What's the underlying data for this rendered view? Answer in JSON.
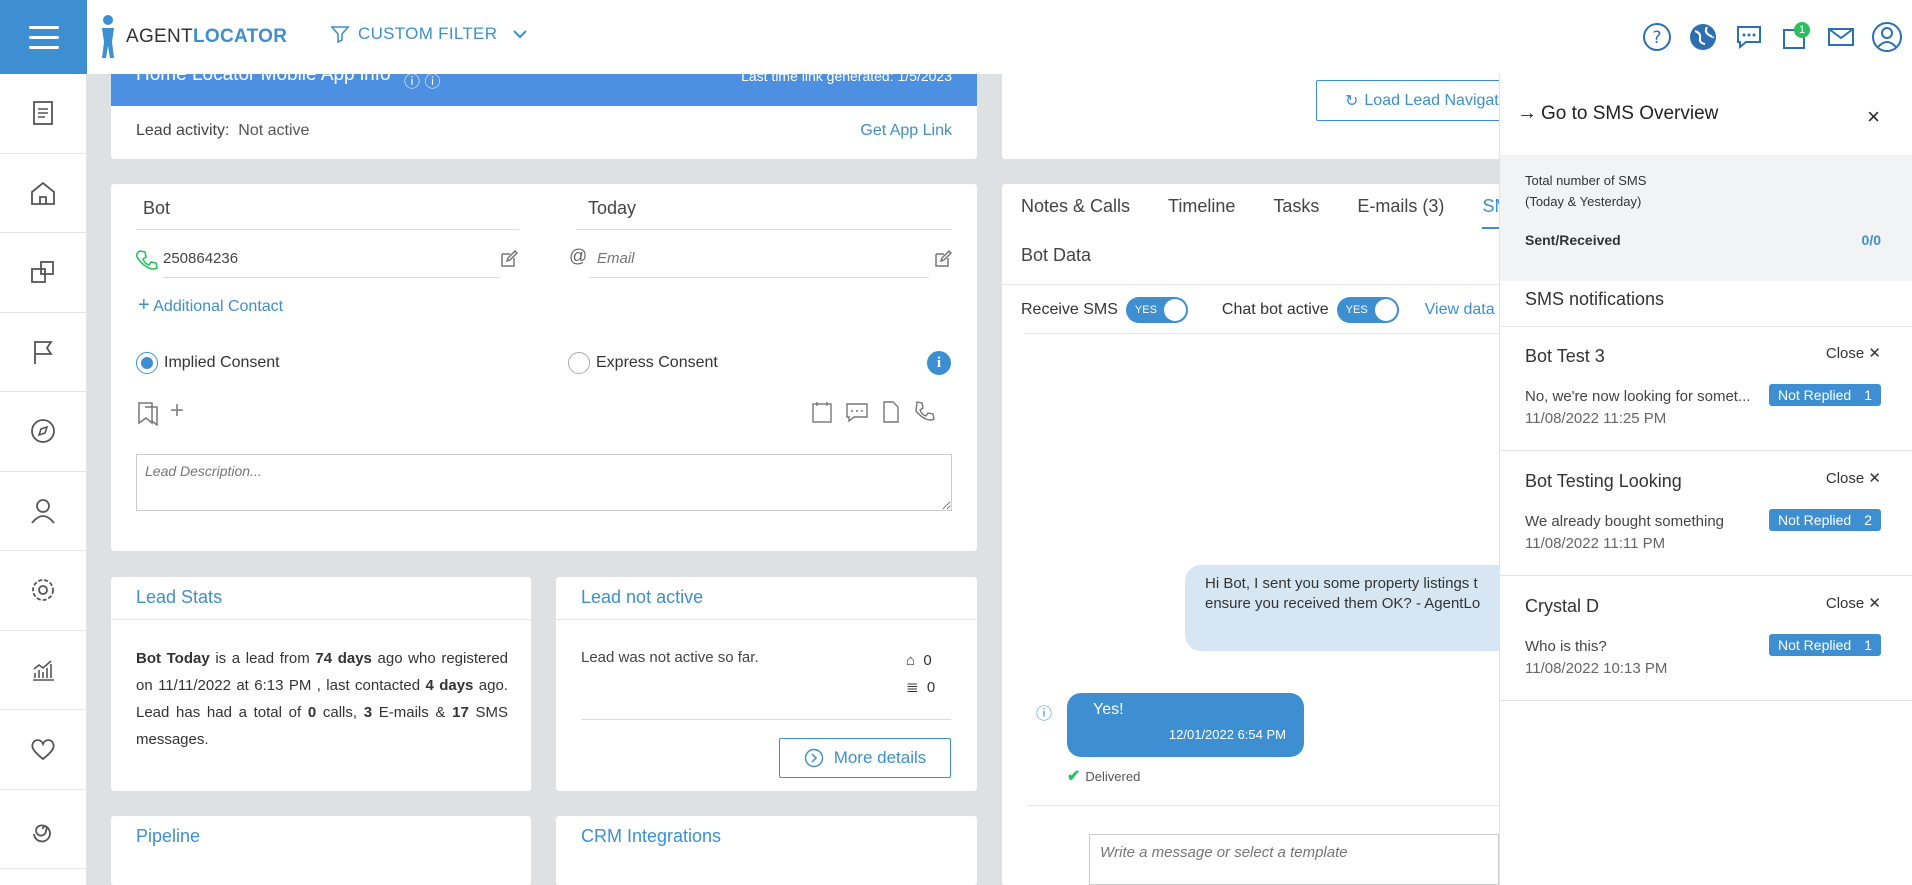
{
  "app": {
    "logo_agent": "AGENT",
    "logo_locator": "LOCATOR",
    "custom_filter": "CUSTOM FILTER",
    "notification_count": "1"
  },
  "app_info": {
    "title": "Home Locator Mobile App info",
    "last_link": "Last time link generated: 1/5/2023",
    "lead_activity_label": "Lead activity:",
    "lead_activity_value": "Not active",
    "get_app_link": "Get App Link"
  },
  "contact": {
    "first_name": "Bot",
    "last_name": "Today",
    "phone": "250864236",
    "email_placeholder": "Email",
    "additional_contact": "Additional Contact",
    "implied_consent": "Implied Consent",
    "express_consent": "Express Consent",
    "description_placeholder": "Lead Description..."
  },
  "lead_stats": {
    "title": "Lead Stats",
    "t1": "Bot Today",
    "t2": " is a lead from ",
    "t3": "74 days",
    "t4": " ago who registered on 11/11/2022 at 6:13 PM , last contacted ",
    "t5": "4 days",
    "t6": " ago. Lead has had a total of ",
    "t7": "0",
    "t8": " calls, ",
    "t9": "3",
    "t10": " E-mails & ",
    "t11": "17",
    "t12": " SMS messages."
  },
  "lead_activity": {
    "title": "Lead not active",
    "text": "Lead was not active so far.",
    "homes": "0",
    "db": "0",
    "more_details": "More details"
  },
  "pipeline": {
    "title": "Pipeline"
  },
  "crm": {
    "title": "CRM Integrations"
  },
  "right": {
    "load_lead_nav": "Load Lead Navigat",
    "tabs": [
      "Notes & Calls",
      "Timeline",
      "Tasks",
      "E-mails (3)",
      "SMS"
    ],
    "bot_data": "Bot Data",
    "receive_sms": "Receive SMS",
    "chat_bot_active": "Chat bot active",
    "toggle_yes": "YES",
    "view_data": "View data c"
  },
  "chat": {
    "out_line1": "Hi Bot, I sent you some property listings t",
    "out_line2": "ensure you received them OK? - AgentLo",
    "in_text": "Yes!",
    "in_time": "12/01/2022 6:54 PM",
    "delivered": "Delivered",
    "compose_placeholder": "Write a message or select a template"
  },
  "sms_panel": {
    "goto": "Go to SMS Overview",
    "total_label_1": "Total number of SMS",
    "total_label_2": "(Today & Yesterday)",
    "sent_received_label": "Sent/Received",
    "sent_received_value": "0/0",
    "notifications_title": "SMS notifications",
    "close_label": "Close",
    "not_replied": "Not Replied",
    "items": [
      {
        "name": "Bot Test 3",
        "msg": "No, we're now looking for somet...",
        "time": "11/08/2022 11:25 PM",
        "count": "1"
      },
      {
        "name": "Bot Testing Looking",
        "msg": "We already bought something",
        "time": "11/08/2022 11:11 PM",
        "count": "2"
      },
      {
        "name": "Crystal D",
        "msg": "Who is this?",
        "time": "11/08/2022 10:13 PM",
        "count": "1"
      }
    ]
  },
  "colors": {
    "accent": "#3d8fd1",
    "banner": "#4d8fe0",
    "highlight": "#e4141c",
    "badge": "#2bbf5e"
  }
}
